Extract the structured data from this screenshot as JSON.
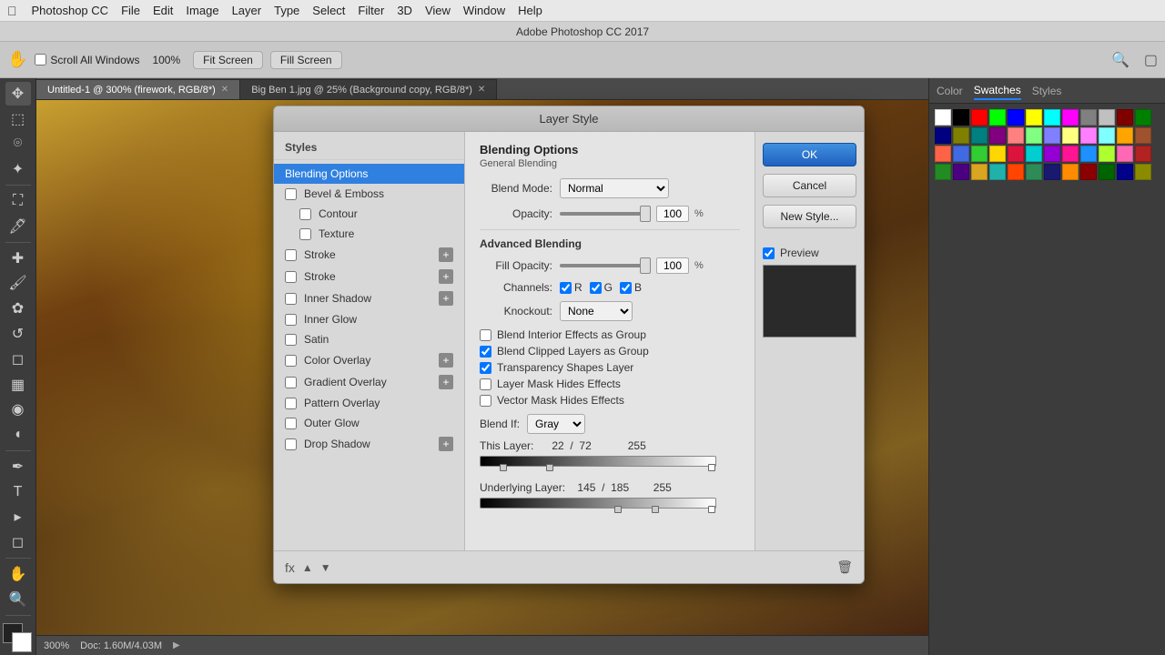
{
  "menubar": {
    "apple": "&#63743;",
    "items": [
      "Photoshop CC",
      "File",
      "Edit",
      "Image",
      "Layer",
      "Type",
      "Select",
      "Filter",
      "3D",
      "View",
      "Window",
      "Help"
    ]
  },
  "titlebar": {
    "text": "Adobe Photoshop CC 2017"
  },
  "toolbar": {
    "scroll_windows_label": "Scroll All Windows",
    "pct": "100%",
    "fit_screen": "Fit Screen",
    "fill_screen": "Fill Screen"
  },
  "canvas": {
    "tabs": [
      {
        "label": "Untitled-1 @ 300% (firework, RGB/8*)",
        "active": true
      },
      {
        "label": "Big Ben 1.jpg @ 25% (Background copy, RGB/8*)",
        "active": false
      }
    ],
    "status": {
      "zoom": "300%",
      "doc": "Doc: 1.60M/4.03M"
    }
  },
  "right_panel": {
    "tabs": [
      "Color",
      "Swatches",
      "Styles"
    ],
    "active_tab": "Swatches",
    "swatches": [
      "#ffffff",
      "#000000",
      "#ff0000",
      "#00ff00",
      "#0000ff",
      "#ffff00",
      "#00ffff",
      "#ff00ff",
      "#808080",
      "#c0c0c0",
      "#800000",
      "#008000",
      "#000080",
      "#808000",
      "#008080",
      "#800080",
      "#ff8080",
      "#80ff80",
      "#8080ff",
      "#ffff80",
      "#ff80ff",
      "#80ffff",
      "#ffa500",
      "#a0522d",
      "#ff6347",
      "#4169e1",
      "#32cd32",
      "#ffd700",
      "#dc143c",
      "#00ced1",
      "#9400d3",
      "#ff1493",
      "#1e90ff",
      "#adff2f",
      "#ff69b4",
      "#b22222",
      "#228b22",
      "#4b0082",
      "#daa520",
      "#20b2aa",
      "#ff4500",
      "#2e8b57",
      "#191970",
      "#ff8c00",
      "#8b0000",
      "#006400",
      "#00008b",
      "#8b8b00"
    ]
  },
  "layer_style": {
    "title": "Layer Style",
    "styles_header": "Styles",
    "blending_options_label": "Blending Options",
    "style_items": [
      {
        "label": "Blending Options",
        "checkbox": false,
        "active": true,
        "plus": false
      },
      {
        "label": "Bevel & Emboss",
        "checkbox": true,
        "checked": false,
        "plus": false,
        "active": false
      },
      {
        "label": "Contour",
        "checkbox": true,
        "checked": false,
        "plus": false,
        "active": false,
        "indent": true
      },
      {
        "label": "Texture",
        "checkbox": true,
        "checked": false,
        "plus": false,
        "active": false,
        "indent": true
      },
      {
        "label": "Stroke",
        "checkbox": true,
        "checked": false,
        "plus": true,
        "active": false
      },
      {
        "label": "Stroke",
        "checkbox": true,
        "checked": false,
        "plus": true,
        "active": false
      },
      {
        "label": "Inner Shadow",
        "checkbox": true,
        "checked": false,
        "plus": true,
        "active": false
      },
      {
        "label": "Inner Glow",
        "checkbox": true,
        "checked": false,
        "plus": false,
        "active": false
      },
      {
        "label": "Satin",
        "checkbox": true,
        "checked": false,
        "plus": false,
        "active": false
      },
      {
        "label": "Color Overlay",
        "checkbox": true,
        "checked": false,
        "plus": true,
        "active": false
      },
      {
        "label": "Gradient Overlay",
        "checkbox": true,
        "checked": false,
        "plus": true,
        "active": false
      },
      {
        "label": "Pattern Overlay",
        "checkbox": true,
        "checked": false,
        "plus": false,
        "active": false
      },
      {
        "label": "Outer Glow",
        "checkbox": true,
        "checked": false,
        "plus": false,
        "active": false
      },
      {
        "label": "Drop Shadow",
        "checkbox": true,
        "checked": false,
        "plus": true,
        "active": false
      }
    ],
    "blending": {
      "section_title": "Blending Options",
      "subsection": "General Blending",
      "blend_mode_label": "Blend Mode:",
      "blend_mode_value": "Normal",
      "opacity_label": "Opacity:",
      "opacity_value": "100",
      "opacity_pct": "%",
      "adv_title": "Advanced Blending",
      "fill_opacity_label": "Fill Opacity:",
      "fill_opacity_value": "100",
      "fill_opacity_pct": "%",
      "channels_label": "Channels:",
      "ch_r": "R",
      "ch_g": "G",
      "ch_b": "B",
      "knockout_label": "Knockout:",
      "knockout_value": "None",
      "checks": [
        {
          "label": "Blend Interior Effects as Group",
          "checked": false
        },
        {
          "label": "Blend Clipped Layers as Group",
          "checked": true
        },
        {
          "label": "Transparency Shapes Layer",
          "checked": true
        },
        {
          "label": "Layer Mask Hides Effects",
          "checked": false
        },
        {
          "label": "Vector Mask Hides Effects",
          "checked": false
        }
      ],
      "blend_if_label": "Blend If:",
      "blend_if_value": "Gray",
      "this_layer_label": "This Layer:",
      "this_layer_nums": "22 / 72        255",
      "underlying_label": "Underlying Layer:",
      "underlying_nums": "145 / 185        255"
    },
    "actions": {
      "ok": "OK",
      "cancel": "Cancel",
      "new_style": "New Style...",
      "preview_label": "Preview"
    },
    "footer": {
      "fx_label": "fx"
    }
  }
}
